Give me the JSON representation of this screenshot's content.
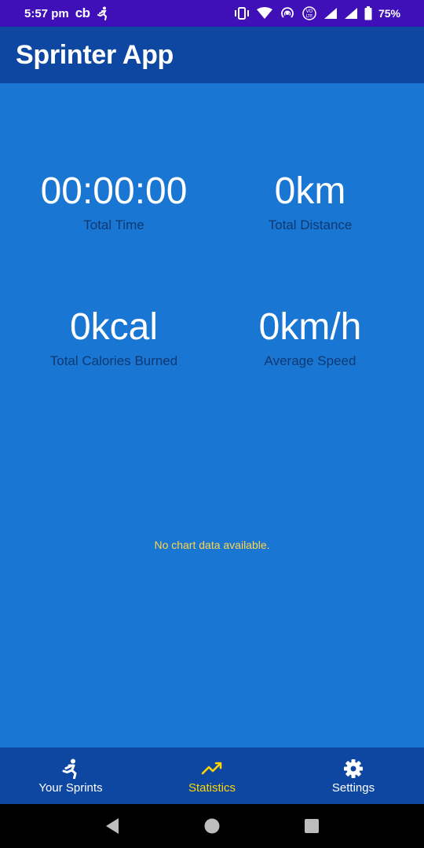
{
  "status_bar": {
    "time": "5:57 pm",
    "carrier_badge": "cb",
    "battery_percent": "75%",
    "icons": [
      "running-icon",
      "vibrate-icon",
      "wifi-icon",
      "hotspot-icon",
      "volte-icon",
      "signal-icon",
      "signal-icon",
      "battery-icon"
    ]
  },
  "app_bar": {
    "title": "Sprinter App"
  },
  "stats": {
    "total_time": {
      "value": "00:00:00",
      "label": "Total Time"
    },
    "total_distance": {
      "value": "0km",
      "label": "Total Distance"
    },
    "total_calories": {
      "value": "0kcal",
      "label": "Total Calories Burned"
    },
    "average_speed": {
      "value": "0km/h",
      "label": "Average Speed"
    }
  },
  "chart": {
    "empty_message": "No chart data available."
  },
  "bottom_nav": {
    "items": [
      {
        "label": "Your Sprints",
        "icon": "running-icon",
        "active": false
      },
      {
        "label": "Statistics",
        "icon": "trending-up-icon",
        "active": true
      },
      {
        "label": "Settings",
        "icon": "gear-icon",
        "active": false
      }
    ]
  },
  "system_nav": {
    "buttons": [
      "back-icon",
      "home-icon",
      "recents-icon"
    ]
  },
  "colors": {
    "status_bar": "#3f0fb8",
    "app_bar": "#0d47a1",
    "background": "#1976d2",
    "accent": "#ffd600",
    "empty_text": "#ffd54f"
  }
}
